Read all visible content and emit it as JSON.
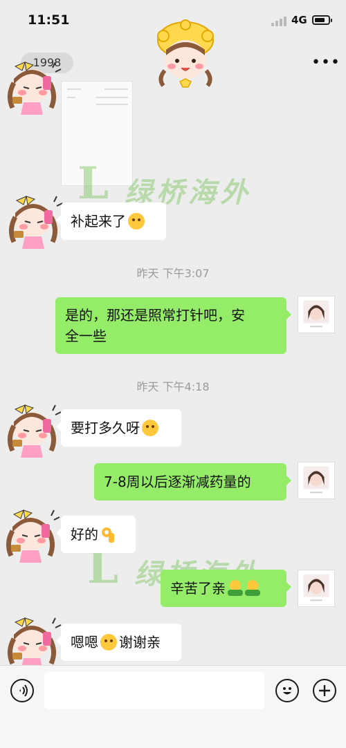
{
  "status_bar": {
    "time": "11:51",
    "network": "4G",
    "battery_level": 0.8
  },
  "nav": {
    "title": "1998",
    "more_icon": "more-icon"
  },
  "colors": {
    "background": "#ededed",
    "bubble_self": "#95ec69",
    "bubble_other": "#ffffff",
    "watermark": "#78c45a"
  },
  "watermark": {
    "logo": "L",
    "text": "绿桥海外"
  },
  "messages": [
    {
      "side": "other",
      "text": "补起来了",
      "emoji": "laughing-face"
    },
    {
      "type": "time",
      "text": "昨天 下午3:07"
    },
    {
      "side": "self",
      "line1": "是的，那还是照常打针吧，安",
      "line2": "全一些"
    },
    {
      "type": "time",
      "text": "昨天 下午4:18"
    },
    {
      "side": "other",
      "text": "要打多久呀",
      "emoji": "laughing-face"
    },
    {
      "side": "self",
      "text": "7-8周以后逐渐减药量的"
    },
    {
      "side": "other",
      "text": "好的",
      "emoji": "ok-hand"
    },
    {
      "side": "self",
      "text": "辛苦了亲",
      "emoji": "hug-face"
    },
    {
      "side": "other",
      "text1": "嗯嗯",
      "text2": "谢谢亲",
      "emoji": "smiling-face"
    }
  ],
  "input_bar": {
    "placeholder": "",
    "voice_icon": "voice-icon",
    "emoji_icon": "emoji-icon",
    "plus_icon": "plus-icon"
  }
}
